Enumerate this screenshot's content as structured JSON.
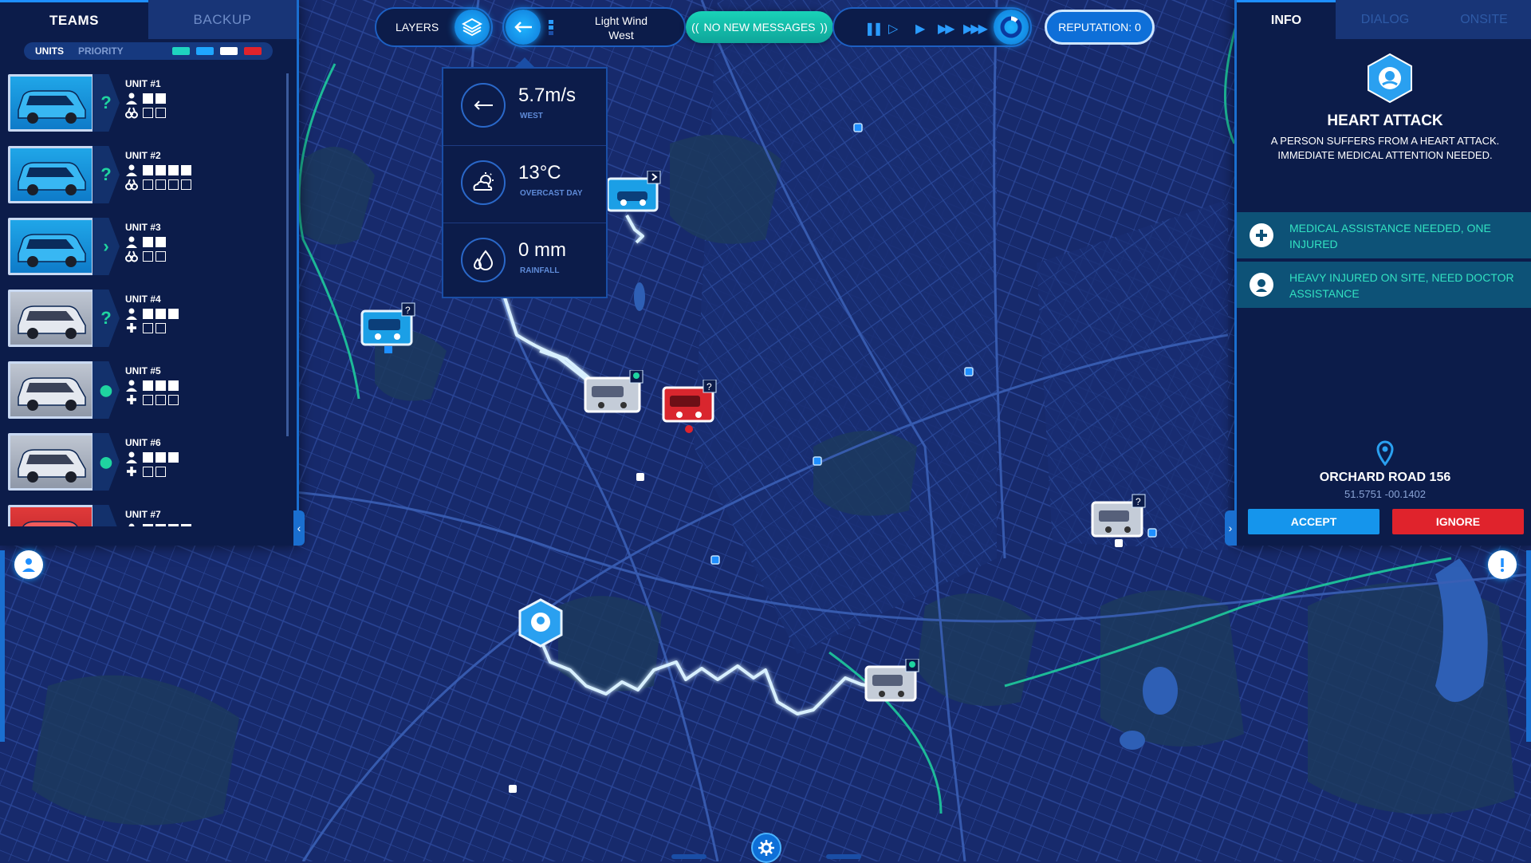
{
  "teams_panel": {
    "tabs": [
      {
        "label": "TEAMS",
        "active": true
      },
      {
        "label": "BACKUP",
        "active": false
      }
    ],
    "sub_tabs": [
      "UNITS",
      "PRIORITY"
    ],
    "priority_colors": [
      "#1fd4c0",
      "#1fa6ff",
      "#ffffff",
      "#e0232c"
    ],
    "units": [
      {
        "name": "UNIT #1",
        "vehicle": "police-car",
        "color": "blue",
        "status": "question-icon",
        "crew": [
          1,
          1
        ],
        "equipment": "binoculars-icon",
        "equip_slots": [
          0,
          0
        ]
      },
      {
        "name": "UNIT #2",
        "vehicle": "police-van",
        "color": "blue",
        "status": "question-icon",
        "crew": [
          1,
          1,
          1,
          1
        ],
        "equipment": "binoculars-icon",
        "equip_slots": [
          0,
          0,
          0,
          0
        ]
      },
      {
        "name": "UNIT #3",
        "vehicle": "police-car",
        "color": "blue",
        "status": "chevron-right-icon",
        "crew": [
          1,
          1
        ],
        "equipment": "binoculars-icon",
        "equip_slots": [
          0,
          0
        ]
      },
      {
        "name": "UNIT #4",
        "vehicle": "ambulance",
        "color": "grey",
        "status": "question-icon",
        "crew": [
          1,
          1,
          1
        ],
        "equipment": "medical-cross-icon",
        "equip_slots": [
          0,
          0
        ]
      },
      {
        "name": "UNIT #5",
        "vehicle": "ambulance",
        "color": "grey",
        "status": "location-pin-icon",
        "crew": [
          1,
          1,
          1
        ],
        "equipment": "medical-cross-icon",
        "equip_slots": [
          0,
          0,
          0
        ]
      },
      {
        "name": "UNIT #6",
        "vehicle": "ambulance",
        "color": "grey",
        "status": "location-pin-icon",
        "crew": [
          1,
          1,
          1
        ],
        "equipment": "medical-cross-icon",
        "equip_slots": [
          0,
          0
        ]
      },
      {
        "name": "UNIT #7",
        "vehicle": "fire-truck",
        "color": "red",
        "status": "",
        "crew": [
          1,
          1,
          1,
          1
        ],
        "equipment": "",
        "equip_slots": []
      }
    ]
  },
  "top_bar": {
    "layers_label": "LAYERS",
    "wind_line1": "Light Wind",
    "wind_line2": "West",
    "messages_label": "NO NEW MESSAGES",
    "reputation_label": "REPUTATION: 0",
    "speed_controls": [
      "pause-icon",
      "play-slow-icon",
      "play-icon",
      "fast-forward-icon",
      "fastest-forward-icon"
    ]
  },
  "weather": {
    "wind_speed": "5.7m/s",
    "wind_dir": "WEST",
    "temperature": "13°C",
    "sky": "OVERCAST DAY",
    "rain": "0 mm",
    "rain_label": "RAINFALL"
  },
  "incident_panel": {
    "tabs": [
      {
        "label": "INFO",
        "active": true
      },
      {
        "label": "DIALOG",
        "active": false
      },
      {
        "label": "ONSITE",
        "active": false
      }
    ],
    "title": "HEART ATTACK",
    "description": "A PERSON SUFFERS FROM A HEART ATTACK. IMMEDIATE MEDICAL ATTENTION NEEDED.",
    "requirements": [
      {
        "icon": "medical-cross-icon",
        "text": "MEDICAL ASSISTANCE NEEDED, ONE INJURED"
      },
      {
        "icon": "doctor-icon",
        "text": "HEAVY INJURED ON SITE, NEED DOCTOR ASSISTANCE"
      }
    ],
    "location_name": "ORCHARD ROAD 156",
    "location_coords": "51.5751 -00.1402",
    "accept_label": "ACCEPT",
    "ignore_label": "IGNORE"
  },
  "map": {
    "route_color": "#d8f0ff",
    "boundary_color": "#1fd4a0",
    "land_color": "#172a6c",
    "park_color": "#1c3a5e"
  }
}
